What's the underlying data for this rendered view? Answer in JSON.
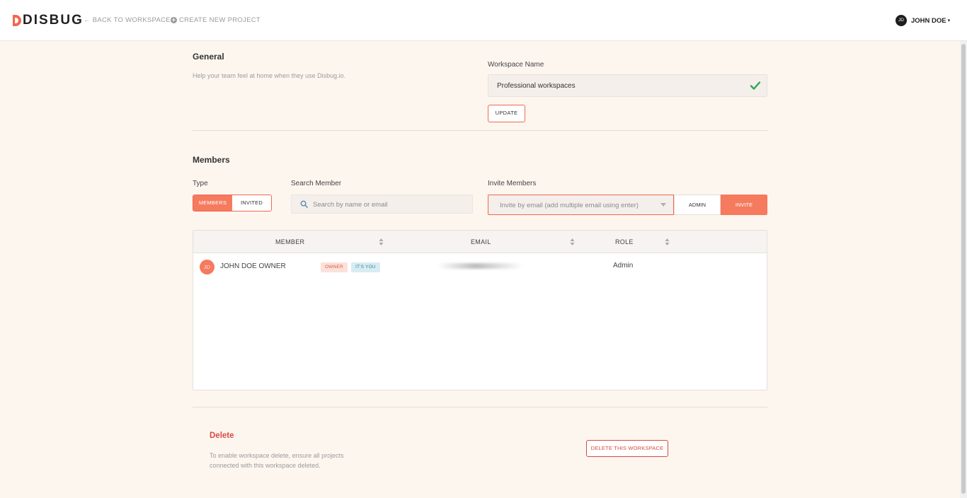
{
  "header": {
    "brand": "DISBUG",
    "back_link": "← BACK TO WORKSPACES",
    "create_link": "CREATE NEW PROJECT",
    "user_initials": "JD",
    "user_name": "JOHN DOE",
    "user_caret": "▾"
  },
  "general": {
    "title": "General",
    "description": "Help your team feel at home when they use Disbug.io.",
    "workspace_label": "Workspace Name",
    "workspace_value": "Professional workspaces",
    "update_label": "UPDATE"
  },
  "members": {
    "title": "Members",
    "type_label": "Type",
    "toggle": {
      "members": "MEMBERS",
      "invited": "INVITED",
      "active": "MEMBERS"
    },
    "search_label": "Search Member",
    "search_placeholder": "Search by name or email",
    "invite_label": "Invite Members",
    "invite_placeholder": "Invite by email (add multiple email using enter)",
    "role_option": "ADMIN",
    "invite_button": "INVITE",
    "table": {
      "columns": [
        "MEMBER",
        "EMAIL",
        "ROLE"
      ],
      "rows": [
        {
          "initials": "JD",
          "name": "JOHN DOE OWNER",
          "badges": [
            "OWNER",
            "IT'S YOU"
          ],
          "role": "Admin"
        }
      ]
    }
  },
  "delete": {
    "title": "Delete",
    "description_line1": "To enable workspace delete, ensure all projects",
    "description_line2": "connected with this workspace deleted.",
    "button": "DELETE THIS WORKSPACE"
  },
  "colors": {
    "accent": "#f57a5e",
    "danger": "#d74a42",
    "background": "#fdf6ef",
    "success": "#2fa84f"
  }
}
